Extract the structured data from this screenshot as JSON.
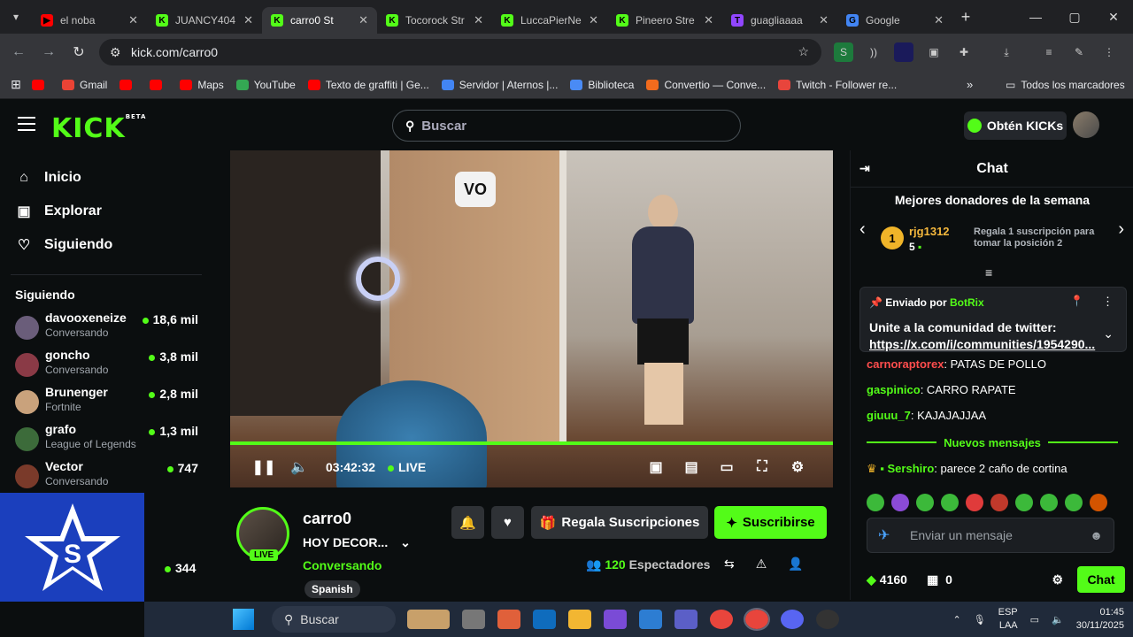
{
  "browser": {
    "tabs": [
      {
        "title": "el noba",
        "color": "#ff0000",
        "letter": "▶",
        "active": false
      },
      {
        "title": "JUANCY404",
        "color": "#53fc18",
        "letter": "K",
        "active": false
      },
      {
        "title": "carro0 St",
        "color": "#53fc18",
        "letter": "K",
        "active": true
      },
      {
        "title": "Tocorock Str",
        "color": "#53fc18",
        "letter": "K",
        "active": false
      },
      {
        "title": "LuccaPierNe",
        "color": "#53fc18",
        "letter": "K",
        "active": false
      },
      {
        "title": "Pineero Stre",
        "color": "#53fc18",
        "letter": "K",
        "active": false
      },
      {
        "title": "guagliaaaa",
        "color": "#9146ff",
        "letter": "T",
        "active": false
      },
      {
        "title": "Google",
        "color": "#4285f4",
        "letter": "G",
        "active": false
      }
    ],
    "url": "kick.com/carro0",
    "bookmarks": [
      "Gmail",
      "Maps",
      "YouTube",
      "Texto de graffiti | Ge...",
      "Servidor | Aternos |...",
      "Biblioteca",
      "Convertio — Conve...",
      "Twitch - Follower re..."
    ],
    "all_bookmarks": "Todos los marcadores"
  },
  "header": {
    "logo": "KICK",
    "beta": "BETA",
    "search_placeholder": "Buscar",
    "get_kicks": "Obtén KICKs"
  },
  "sidebar": {
    "nav": [
      {
        "label": "Inicio",
        "icon": "home-icon"
      },
      {
        "label": "Explorar",
        "icon": "compass-icon"
      },
      {
        "label": "Siguiendo",
        "icon": "heart-icon"
      }
    ],
    "following_title": "Siguiendo",
    "channels": [
      {
        "name": "davooxeneize",
        "status": "Conversando",
        "viewers": "18,6 mil",
        "color": "#6a5d7a"
      },
      {
        "name": "goncho",
        "status": "Conversando",
        "viewers": "3,8 mil",
        "color": "#8a3a46"
      },
      {
        "name": "Brunenger",
        "status": "Fortnite",
        "viewers": "2,8 mil",
        "color": "#c9a27c"
      },
      {
        "name": "grafo",
        "status": "League of Legends",
        "viewers": "1,3 mil",
        "color": "#3c6b3a"
      },
      {
        "name": "Vector",
        "status": "Conversando",
        "viewers": "747",
        "color": "#7a3a2a"
      }
    ],
    "extra_count": "344"
  },
  "player": {
    "time": "03:42:32",
    "live": "LIVE",
    "progress": 1.0
  },
  "stream": {
    "name": "carro0",
    "title": "HOY DECOR...",
    "category": "Conversando",
    "language": "Spanish",
    "live_badge": "LIVE",
    "gift_label": "Regala Suscripciones",
    "subscribe_label": "Suscribirse",
    "viewers_count": "120",
    "viewers_label": "Espectadores"
  },
  "chat": {
    "title": "Chat",
    "donors_title": "Mejores donadores de la semana",
    "top_donor": {
      "rank": "1",
      "name": "rjg1312",
      "amount": "5"
    },
    "donor_cta": "Regala 1 suscripción para tomar la posición 2",
    "pinned": {
      "sent_by": "Enviado por",
      "bot": "BotRix",
      "message": "Unite a la comunidad de twitter:",
      "link": "https://x.com/i/communities/1954290..."
    },
    "messages": [
      {
        "user": "carnoraptorex",
        "text": "PATAS DE POLLO",
        "color": "#ff4d4d"
      },
      {
        "user": "gaspinico",
        "text": "CARRO RAPATE",
        "color": "#53fc18"
      },
      {
        "user": "giuuu_7",
        "text": "KAJAJAJJAA",
        "color": "#53fc18"
      }
    ],
    "new_messages": "Nuevos mensajes",
    "last_message": {
      "user": "Sershiro",
      "text": "parece 2 caño de cortina",
      "color": "#53fc18"
    },
    "input_placeholder": "Enviar un mensaje",
    "kicks": "4160",
    "gifts": "0",
    "send_label": "Chat"
  },
  "taskbar": {
    "search": "Buscar",
    "lang": "ESP",
    "layout": "LAA",
    "time": "01:45",
    "date": "30/11/2025"
  },
  "colors": {
    "accent": "#53fc18",
    "bg": "#0b0e0f"
  }
}
